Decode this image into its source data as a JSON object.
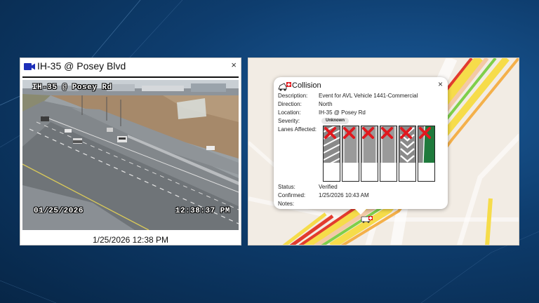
{
  "camera": {
    "title": "IH-35 @ Posey Blvd",
    "feed_overlay_location": "IH-35 @ Posey Rd",
    "feed_overlay_date": "01/25/2026",
    "feed_overlay_time": "12:38:37 PM",
    "caption": "1/25/2026 12:38 PM",
    "close_glyph": "×"
  },
  "incident": {
    "title": "Collision",
    "close_glyph": "×",
    "fields": {
      "description_label": "Description:",
      "description_value": "Event for AVL Vehicle 1441-Commercial",
      "direction_label": "Direction:",
      "direction_value": "North",
      "location_label": "Location:",
      "location_value": "IH-35 @ Posey Rd",
      "severity_label": "Severity:",
      "severity_value": "Unknown",
      "lanes_label": "Lanes Affected:",
      "status_label": "Status:",
      "status_value": "Verified",
      "confirmed_label": "Confirmed:",
      "confirmed_value": "1/25/2026 10:43 AM",
      "notes_label": "Notes:",
      "notes_value": ""
    },
    "lanes": [
      {
        "type": "shoulder-left",
        "pattern": "diagonal",
        "blocked": true
      },
      {
        "type": "travel",
        "pattern": "solid",
        "blocked": true
      },
      {
        "type": "travel",
        "pattern": "solid",
        "blocked": true
      },
      {
        "type": "travel",
        "pattern": "solid",
        "blocked": true
      },
      {
        "type": "exit",
        "pattern": "chevron",
        "blocked": true
      },
      {
        "type": "shoulder-right",
        "pattern": "green-shoulder",
        "blocked": true
      }
    ]
  },
  "colors": {
    "background": "#0e3d6e",
    "panel": "#ffffff",
    "map_background": "#f2ece4",
    "traffic_red": "#e23b2e",
    "traffic_yellow": "#f5d63c",
    "traffic_green": "#7fcf4a",
    "blocked_x": "#e0191e",
    "shoulder_green": "#1f7a3c",
    "camera_icon": "#1d2fb8"
  },
  "icons": {
    "camera": "video-camera-icon",
    "collision": "collision-car-icon",
    "close": "close-icon",
    "blocked": "red-x-icon",
    "map_marker": "collision-marker-icon"
  }
}
